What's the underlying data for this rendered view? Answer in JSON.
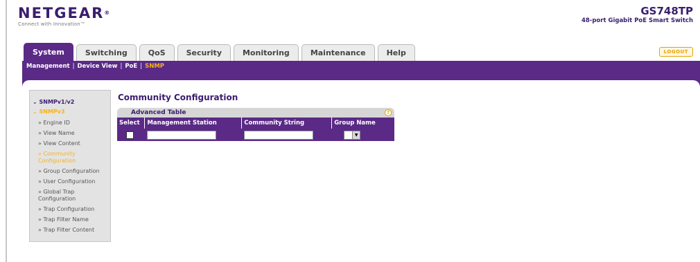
{
  "brand": {
    "logo": "NETGEAR",
    "registered": "®",
    "tagline": "Connect with Innovation™",
    "model": "GS748TP",
    "model_desc": "48-port Gigabit PoE Smart Switch"
  },
  "tabs": [
    {
      "label": "System",
      "active": true
    },
    {
      "label": "Switching"
    },
    {
      "label": "QoS"
    },
    {
      "label": "Security"
    },
    {
      "label": "Monitoring"
    },
    {
      "label": "Maintenance"
    },
    {
      "label": "Help"
    }
  ],
  "logout_label": "LOGOUT",
  "submenu": [
    {
      "label": "Management"
    },
    {
      "label": "Device View"
    },
    {
      "label": "PoE"
    },
    {
      "label": "SNMP",
      "active": true
    }
  ],
  "sidenav": {
    "group1": "SNMPv1/v2",
    "group2": "SNMPv3",
    "items": [
      "» Engine ID",
      "» View Name",
      "» View Content",
      "» Community Configuration",
      "» Group Configuration",
      "» User Configuration",
      "» Global Trap Configuration",
      "» Trap Configuration",
      "» Trap Filter Name",
      "» Trap Filter Content"
    ]
  },
  "main": {
    "title": "Community Configuration",
    "table_label": "Advanced Table",
    "columns": [
      "Select",
      "Management Station",
      "Community String",
      "Group Name"
    ],
    "row": {
      "management_station": "",
      "community_string": "",
      "group_name": ""
    }
  },
  "colors": {
    "brand_purple": "#5a2a86",
    "accent_orange": "#f7b21b"
  }
}
